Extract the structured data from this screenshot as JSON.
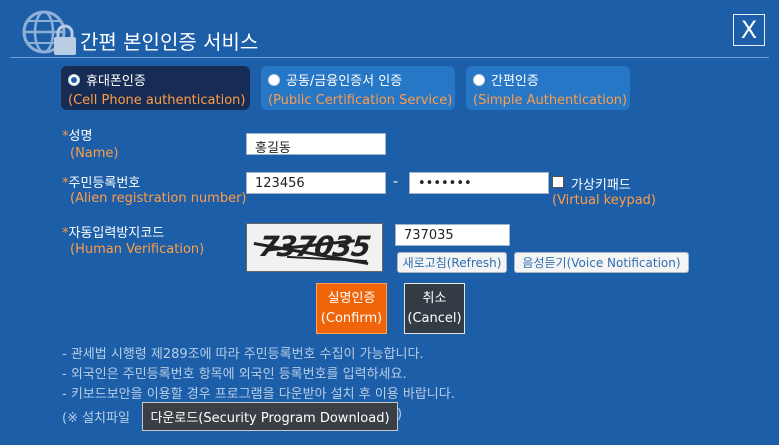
{
  "title": "간편 본인인증 서비스",
  "close_label": "X",
  "tabs": [
    {
      "label": "휴대폰인증",
      "sub": "(Cell Phone authentication)"
    },
    {
      "label": "공동/금융인증서 인증",
      "sub": "(Public Certification Service)"
    },
    {
      "label": "간편인증",
      "sub": "(Simple Authentication)"
    }
  ],
  "form": {
    "name": {
      "asterisk": "*",
      "label": "성명",
      "sub": "(Name)",
      "value": "홍길동"
    },
    "regno": {
      "asterisk": "*",
      "label": "주민등록번호",
      "sub": "(Alien registration number)",
      "first": "123456",
      "dash": "-",
      "second": "•••••••"
    },
    "keypad": {
      "label": "가상키패드",
      "sub": "(Virtual keypad)"
    },
    "captcha": {
      "asterisk": "*",
      "label": "자동입력방지코드",
      "sub": "(Human Verification)",
      "image_text": "737035",
      "value": "737035",
      "refresh": "새로고침(Refresh)",
      "voice": "음성듣기(Voice Notification)"
    }
  },
  "buttons": {
    "confirm_line1": "실명인증",
    "confirm_line2": "(Confirm)",
    "cancel_line1": "취소",
    "cancel_line2": "(Cancel)"
  },
  "notices": [
    "- 관세법 시행령 제289조에 따라 주민등록번호 수집이 가능합니다.",
    "- 외국인은 주민등록번호 항목에 외국인 등록번호를 입력하세요.",
    "- 키보드보안을 이용할 경우 프로그램을 다운받아 설치 후 이용 바랍니다."
  ],
  "install": {
    "prefix": "(※ 설치파일",
    "tooltip": "다운로드(Security Program Download)",
    "suffix": ")"
  }
}
